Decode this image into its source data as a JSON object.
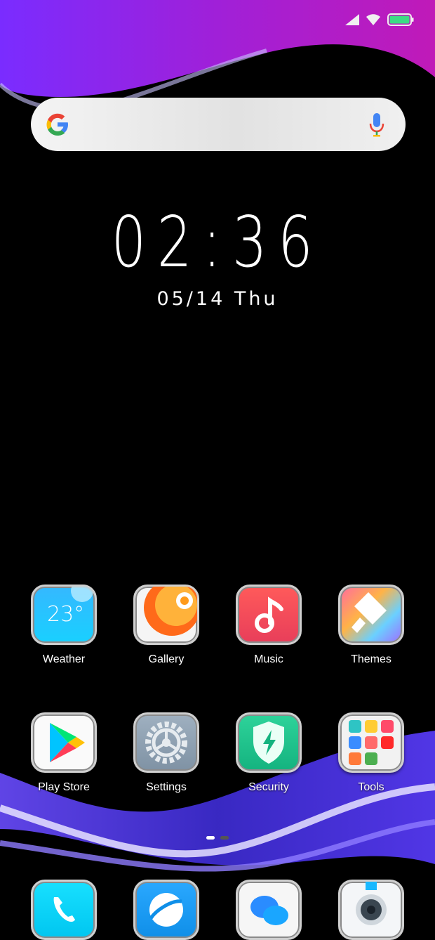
{
  "status": {
    "signal": "signal-icon",
    "wifi": "wifi-icon",
    "battery": "battery-icon",
    "battery_color": "#3ddc84"
  },
  "search": {
    "logo": "google-logo-icon",
    "mic": "mic-icon"
  },
  "clock": {
    "time": "02:36",
    "date": "05/14 Thu"
  },
  "home_apps": [
    {
      "label": "Weather",
      "icon": "weather-icon",
      "temp": "23°"
    },
    {
      "label": "Gallery",
      "icon": "gallery-icon"
    },
    {
      "label": "Music",
      "icon": "music-icon"
    },
    {
      "label": "Themes",
      "icon": "themes-icon"
    },
    {
      "label": "Play Store",
      "icon": "play-store-icon"
    },
    {
      "label": "Settings",
      "icon": "settings-icon"
    },
    {
      "label": "Security",
      "icon": "security-icon"
    },
    {
      "label": "Tools",
      "icon": "tools-folder-icon"
    }
  ],
  "page_indicator": {
    "pages": 2,
    "current": 1
  },
  "dock": [
    {
      "icon": "phone-icon"
    },
    {
      "icon": "browser-icon"
    },
    {
      "icon": "messages-icon"
    },
    {
      "icon": "camera-icon"
    }
  ]
}
